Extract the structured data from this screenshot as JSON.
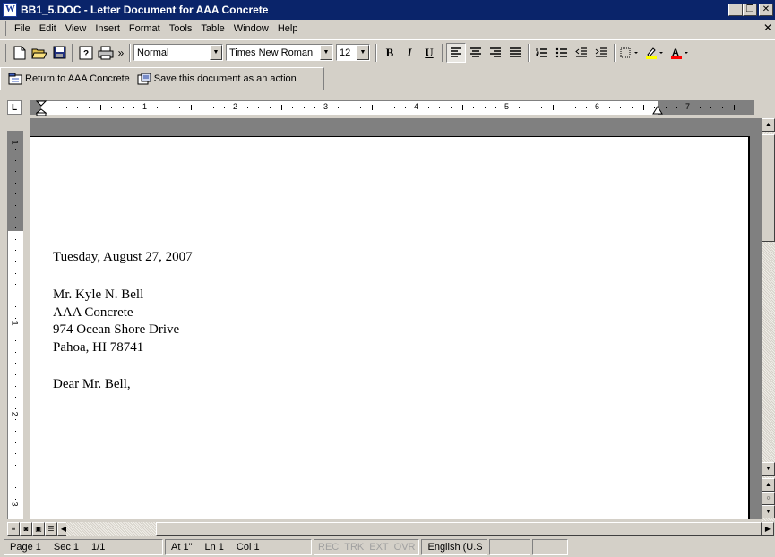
{
  "window": {
    "title": "BB1_5.DOC - Letter Document for AAA Concrete",
    "minimize": "_",
    "restore": "❐",
    "close": "✕"
  },
  "menu": {
    "items": [
      "File",
      "Edit",
      "View",
      "Insert",
      "Format",
      "Tools",
      "Table",
      "Window",
      "Help"
    ],
    "doc_close": "✕"
  },
  "toolbar": {
    "style": "Normal",
    "font": "Times New Roman",
    "size": "12",
    "bold": "B",
    "italic": "I",
    "underline": "U",
    "overflow": "»"
  },
  "action_bar": {
    "return_label": "Return to AAA Concrete",
    "save_label": "Save this document as an action"
  },
  "ruler": {
    "corner": "L",
    "marks": [
      "1",
      "2",
      "3",
      "4",
      "5",
      "6",
      "7"
    ],
    "vmarks": [
      "1",
      "1",
      "2",
      "3"
    ]
  },
  "document": {
    "date": "Tuesday, August 27, 2007",
    "recipient_name": "Mr. Kyle N. Bell",
    "company": "AAA Concrete",
    "street": "974 Ocean Shore Drive",
    "city": "Pahoa, HI 78741",
    "salutation": "Dear Mr. Bell,"
  },
  "status": {
    "page": "Page 1",
    "sec": "Sec 1",
    "pages": "1/1",
    "at": "At 1\"",
    "ln": "Ln 1",
    "col": "Col 1",
    "rec": "REC",
    "trk": "TRK",
    "ext": "EXT",
    "ovr": "OVR",
    "language": "English (U.S"
  },
  "colors": {
    "titlebar": "#0a246a",
    "chrome": "#d4d0c8",
    "highlight": "#ffff00",
    "font_color": "#ff0000"
  }
}
